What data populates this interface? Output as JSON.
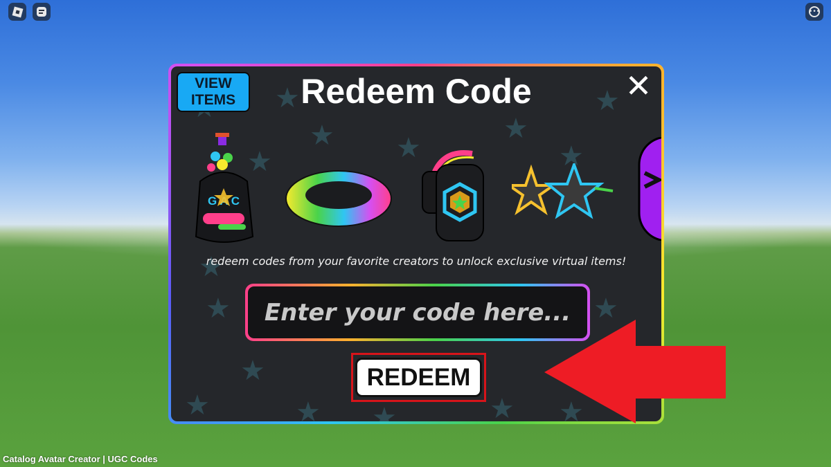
{
  "topbar": {
    "roblox_menu_icon": "roblox-logo-icon",
    "chat_icon": "chat-icon",
    "more_icon": "more-options-icon"
  },
  "panel": {
    "title": "Redeem Code",
    "view_items_line1": "VIEW",
    "view_items_line2": "ITEMS",
    "close_glyph": "✕",
    "subtitle": "redeem codes from your favorite creators to unlock exclusive virtual items!",
    "code_input": {
      "value": "",
      "placeholder": "Enter your code here..."
    },
    "redeem_label": "REDEEM",
    "showcase_items": [
      "ugc-backpack",
      "rainbow-ring",
      "headphones",
      "star-sunglasses",
      "purple-head"
    ],
    "backpack_letters": "G A C"
  },
  "caption": "Catalog Avatar Creator | UGC Codes",
  "colors": {
    "panel_bg": "#25272b",
    "view_items_bg": "#18a9f4",
    "highlight_red": "#d7141a",
    "arrow_red": "#ee1c25"
  }
}
